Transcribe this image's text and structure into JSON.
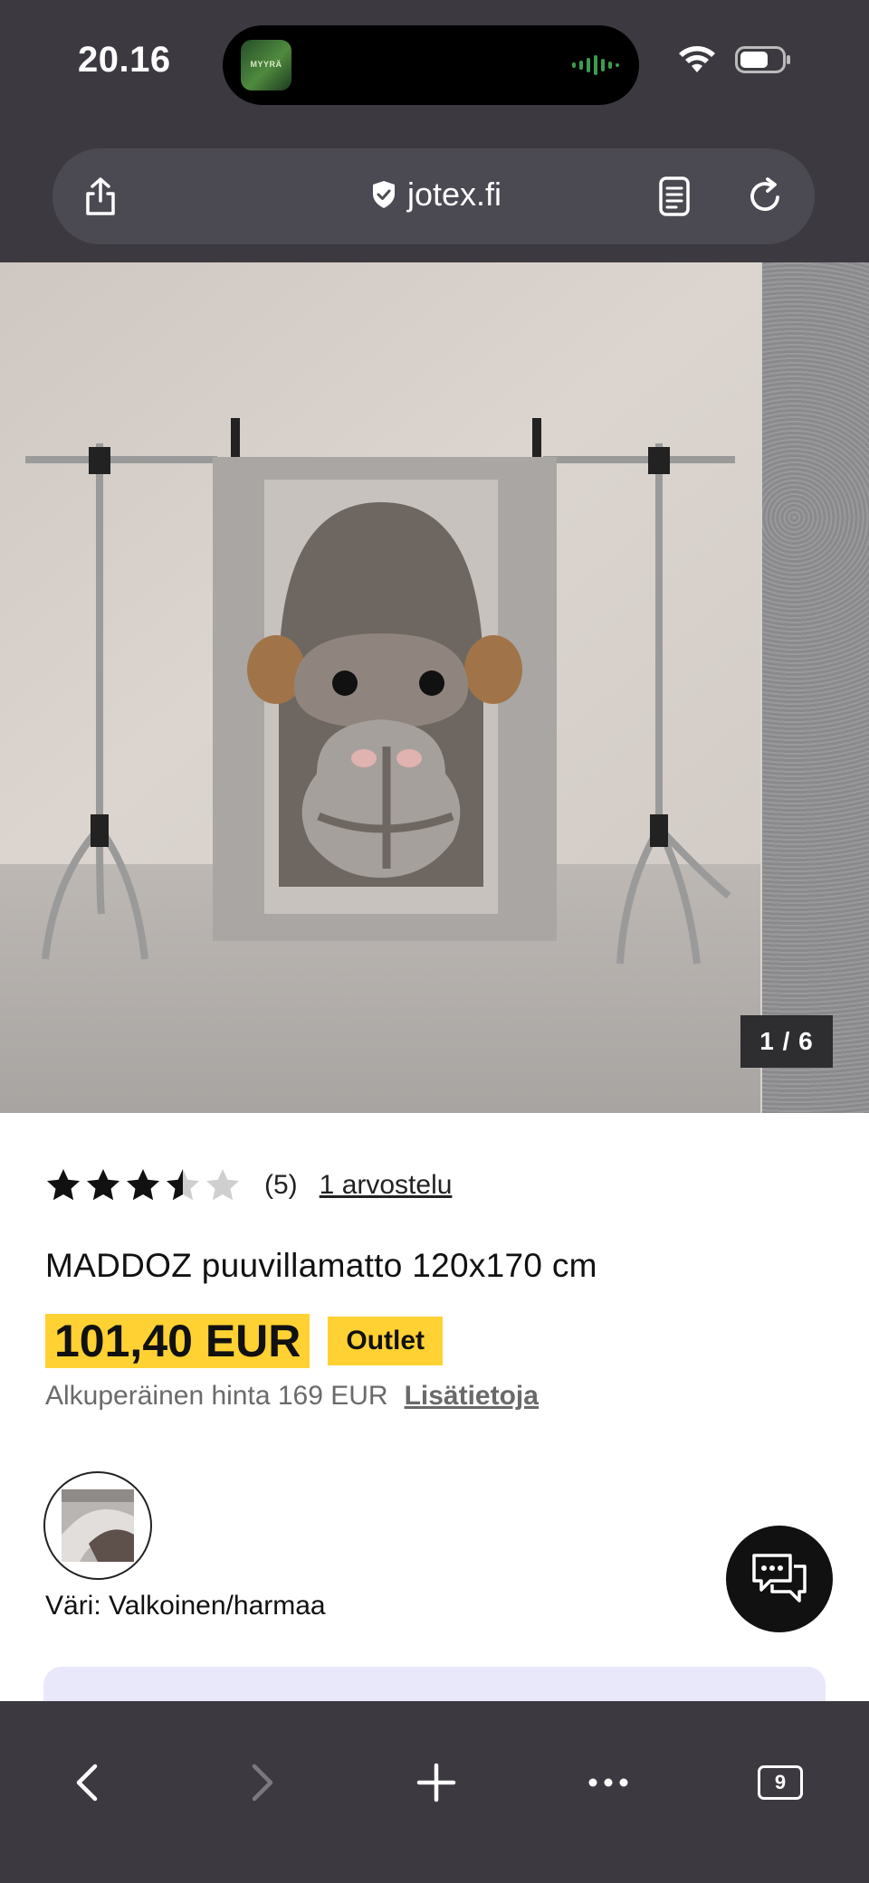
{
  "status_bar": {
    "time": "20.16",
    "island_app_label": "MYYRÄ"
  },
  "browser": {
    "url": "jotex.fi"
  },
  "gallery": {
    "counter": "1 / 6"
  },
  "product": {
    "rating_value": 3.5,
    "rating_max": 5,
    "rating_count": "(5)",
    "reviews_link": "1 arvostelu",
    "title": "MADDOZ puuvillamatto 120x170 cm",
    "price": "101,40 EUR",
    "badge": "Outlet",
    "original_price": "Alkuperäinen hinta 169 EUR",
    "more_info": "Lisätietoja",
    "color_label": "Väri: Valkoinen/harmaa"
  },
  "toolbar": {
    "tabs_count": "9"
  },
  "colors": {
    "chrome": "#3c3a40",
    "price_highlight": "#ffd133",
    "info_card": "#e9e8fb"
  },
  "icons": [
    "share-icon",
    "shield-icon",
    "reader-icon",
    "reload-icon",
    "wifi-icon",
    "battery-icon",
    "star-icon",
    "chat-icon",
    "back-icon",
    "forward-icon",
    "plus-icon",
    "more-icon",
    "tabs-icon"
  ]
}
